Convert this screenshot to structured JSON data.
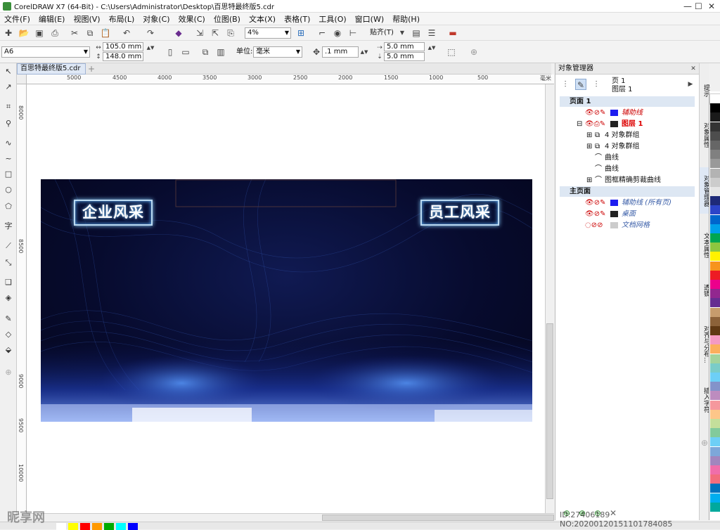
{
  "window": {
    "title": "CorelDRAW X7 (64-Bit) - C:\\Users\\Administrator\\Desktop\\百思特最终版5.cdr"
  },
  "menu": [
    "文件(F)",
    "编辑(E)",
    "视图(V)",
    "布局(L)",
    "对象(C)",
    "效果(C)",
    "位图(B)",
    "文本(X)",
    "表格(T)",
    "工具(O)",
    "窗口(W)",
    "帮助(H)"
  ],
  "toolbar": {
    "zoom": "4%",
    "snap_label": "贴齐(T)"
  },
  "property_bar": {
    "page_size": "A6",
    "width": "105.0 mm",
    "height": "148.0 mm",
    "units_label": "单位:",
    "units": "毫米",
    "nudge": ".1 mm",
    "dup_x": "5.0 mm",
    "dup_y": "5.0 mm"
  },
  "document_tab": {
    "label": "百思特最终版5.cdr"
  },
  "ruler_h": [
    "5000",
    "4500",
    "4000",
    "3500",
    "3000",
    "2500",
    "2000",
    "1500",
    "1000",
    "500",
    "毫米"
  ],
  "ruler_v": [
    "8000",
    "8500",
    "9000",
    "9500",
    "10000"
  ],
  "artwork": {
    "left_badge": "企业风采",
    "right_badge": "员工风采"
  },
  "object_manager": {
    "title": "对象管理器",
    "page": "页 1",
    "layer": "图层 1",
    "rows": [
      {
        "label": "页面 1",
        "type": "header"
      },
      {
        "label": "辅助线",
        "type": "layer"
      },
      {
        "label": "图层 1",
        "type": "layer-active"
      },
      {
        "label": "4 对象群组",
        "type": "item"
      },
      {
        "label": "4 对象群组",
        "type": "item"
      },
      {
        "label": "曲线",
        "type": "item"
      },
      {
        "label": "曲线",
        "type": "item"
      },
      {
        "label": "图框精确剪裁曲线",
        "type": "item"
      },
      {
        "label": "主页面",
        "type": "header"
      },
      {
        "label": "辅助线 (所有页)",
        "type": "master"
      },
      {
        "label": "桌面",
        "type": "master"
      },
      {
        "label": "文档网格",
        "type": "master"
      }
    ]
  },
  "side_tabs": [
    "提示",
    "对象属性",
    "对象管理器",
    "文本属性",
    "透镜",
    "对齐与分布...",
    "插入字符"
  ],
  "palette": [
    "#ffffff",
    "#000000",
    "#1a1a1a",
    "#333333",
    "#4d4d4d",
    "#666666",
    "#808080",
    "#999999",
    "#b3b3b3",
    "#cccccc",
    "#e6e6e6",
    "#1e2a78",
    "#2c44c8",
    "#0066cc",
    "#00a0e9",
    "#00a651",
    "#8dc63f",
    "#fff200",
    "#f7941d",
    "#ed1c24",
    "#ec008c",
    "#92278f",
    "#662d91",
    "#c69c6d",
    "#8c6239",
    "#603913",
    "#f49ac2",
    "#fbaf5d",
    "#a3d39c",
    "#7accc8",
    "#6dcff6",
    "#8393ca",
    "#bd8cbf",
    "#f5989d",
    "#fdc689",
    "#c4df9b",
    "#82ca9c",
    "#6ecff6",
    "#7da7d9",
    "#a186be",
    "#f06eaa",
    "#f26d7d",
    "#0072bc",
    "#00aeef",
    "#00a99d"
  ],
  "bottom_palette": [
    "#ffffff",
    "#ffff00",
    "#ff0000",
    "#ff9900",
    "#00aa00",
    "#00ffff",
    "#0000ff"
  ],
  "watermark": {
    "left": "昵享网",
    "right": "ID:27406189 NO:20200120151101784085"
  }
}
